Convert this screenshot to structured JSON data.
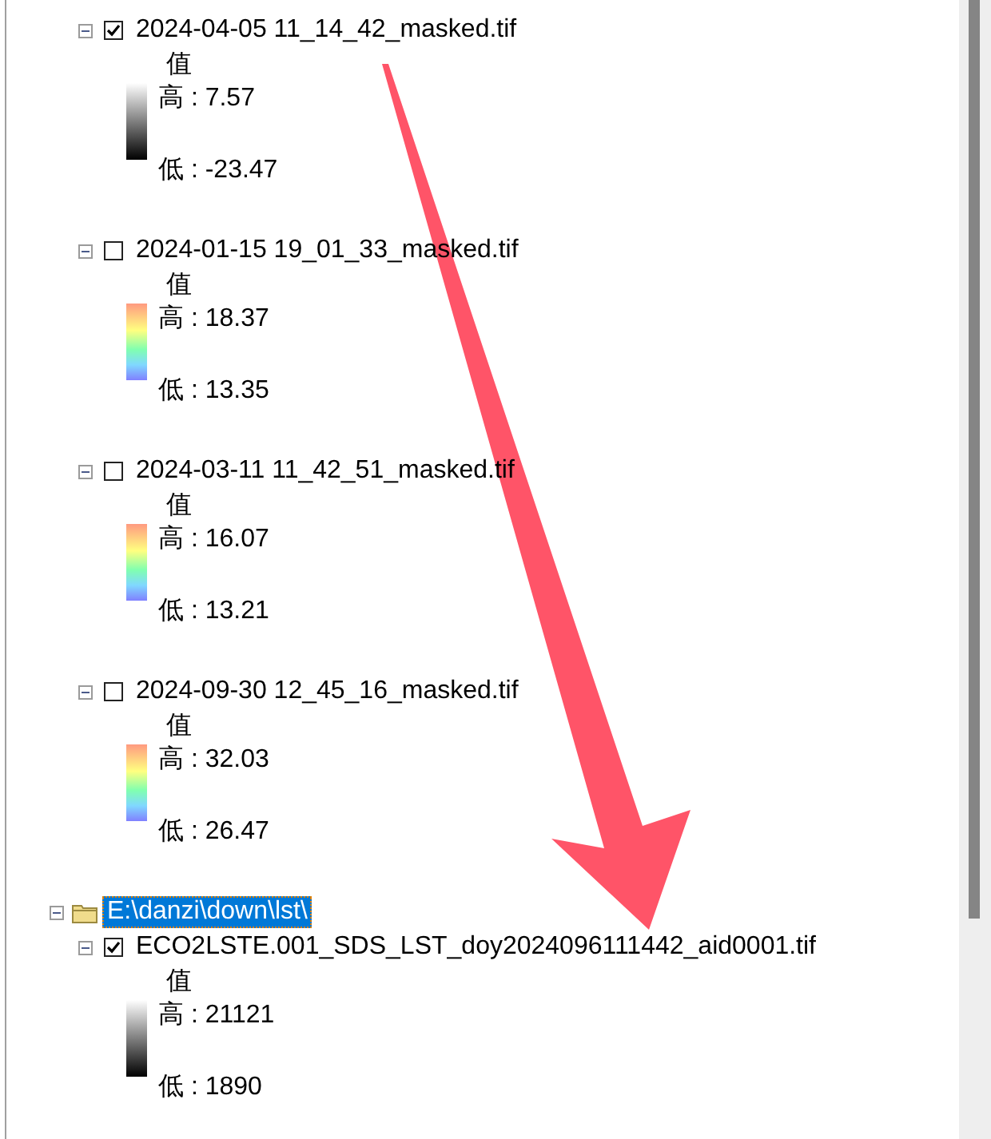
{
  "layers": [
    {
      "name": "2024-04-05 11_14_42_masked.tif",
      "expanded": true,
      "checked": true,
      "legend": {
        "heading": "值",
        "high": "高 : 7.57",
        "low": "低 : -23.47",
        "kind": "grayscale"
      }
    },
    {
      "name": "2024-01-15 19_01_33_masked.tif",
      "expanded": true,
      "checked": false,
      "legend": {
        "heading": "值",
        "high": "高 : 18.37",
        "low": "低 : 13.35",
        "kind": "rainbow"
      }
    },
    {
      "name": "2024-03-11 11_42_51_masked.tif",
      "expanded": true,
      "checked": false,
      "legend": {
        "heading": "值",
        "high": "高 : 16.07",
        "low": "低 : 13.21",
        "kind": "rainbow"
      }
    },
    {
      "name": "2024-09-30 12_45_16_masked.tif",
      "expanded": true,
      "checked": false,
      "legend": {
        "heading": "值",
        "high": "高 : 32.03",
        "low": "低 : 26.47",
        "kind": "rainbow"
      }
    }
  ],
  "groups": [
    {
      "path": "E:\\danzi\\down\\lst\\",
      "expanded": true,
      "selected": true,
      "layers": [
        {
          "name": "ECO2LSTE.001_SDS_LST_doy2024096111442_aid0001.tif",
          "expanded": true,
          "checked": true,
          "legend": {
            "heading": "值",
            "high": "高 : 21121",
            "low": "低 : 1890",
            "kind": "grayscale"
          }
        }
      ]
    }
  ]
}
